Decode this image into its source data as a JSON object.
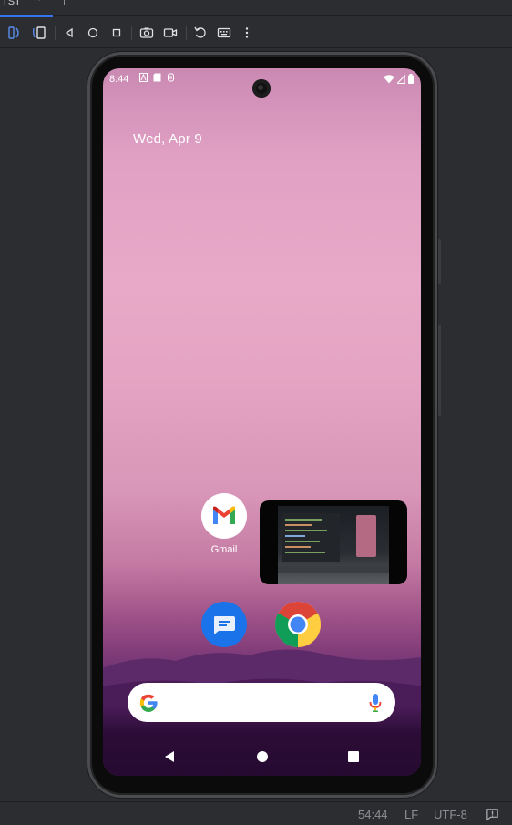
{
  "tab": {
    "label": "TST",
    "close": "×"
  },
  "toolbar": {
    "icons": [
      "fold-icon",
      "unfold-icon",
      "back-icon",
      "home-icon",
      "overview-icon",
      "screenshot-icon",
      "record-icon",
      "rotate-icon",
      "keyboard-icon",
      "more-icon"
    ]
  },
  "phone": {
    "status": {
      "time": "8:44"
    },
    "date": "Wed, Apr 9",
    "apps": [
      {
        "label": "Gmail",
        "icon": "gmail-icon"
      },
      {
        "label": "",
        "icon": "messages-icon"
      },
      {
        "label": "",
        "icon": "chrome-icon"
      }
    ],
    "search": {
      "icon": "google-icon",
      "mic": "mic-icon"
    },
    "nav": [
      "back-icon",
      "home-icon",
      "recents-icon"
    ]
  },
  "statusbar": {
    "position": "54:44",
    "line_ending": "LF",
    "encoding": "UTF-8"
  },
  "colors": {
    "accent": "#3574f0",
    "ide_bg": "#2b2d30",
    "wallpaper_top": "#e0a0c4",
    "wallpaper_bottom": "#3a1246"
  }
}
